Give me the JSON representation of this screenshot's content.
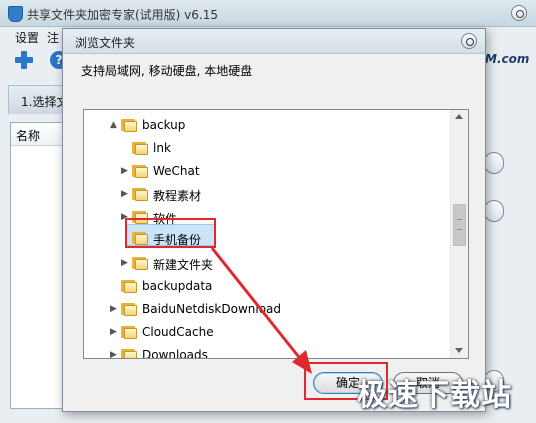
{
  "main": {
    "title": "共享文件夹加密专家(试用版) v6.15",
    "menu": [
      "设置",
      "注"
    ],
    "brand": "M.com",
    "step_tab": "1.选择文",
    "list_header": "名称"
  },
  "dialog": {
    "title": "浏览文件夹",
    "description": "支持局域网, 移动硬盘, 本地硬盘",
    "tree": [
      {
        "label": "backup",
        "expander": "▲"
      },
      {
        "label": "lnk",
        "expander": ""
      },
      {
        "label": "WeChat",
        "expander": "▶"
      },
      {
        "label": "教程素材",
        "expander": "▶"
      },
      {
        "label": "软件",
        "expander": "▶"
      },
      {
        "label": "手机备份",
        "expander": ""
      },
      {
        "label": "新建文件夹",
        "expander": "▶"
      },
      {
        "label": "backupdata",
        "expander": ""
      },
      {
        "label": "BaiduNetdiskDownload",
        "expander": "▶"
      },
      {
        "label": "CloudCache",
        "expander": "▶"
      },
      {
        "label": "Downloads",
        "expander": "▶"
      }
    ],
    "ok_label": "确定",
    "cancel_label": "取消"
  },
  "watermark": "极速下载站",
  "colors": {
    "annotation": "#e0292f",
    "selection": "#cce4f7"
  },
  "icons": [
    "app-shield-icon",
    "add-icon",
    "help-icon",
    "folder-icon",
    "close-icon"
  ]
}
